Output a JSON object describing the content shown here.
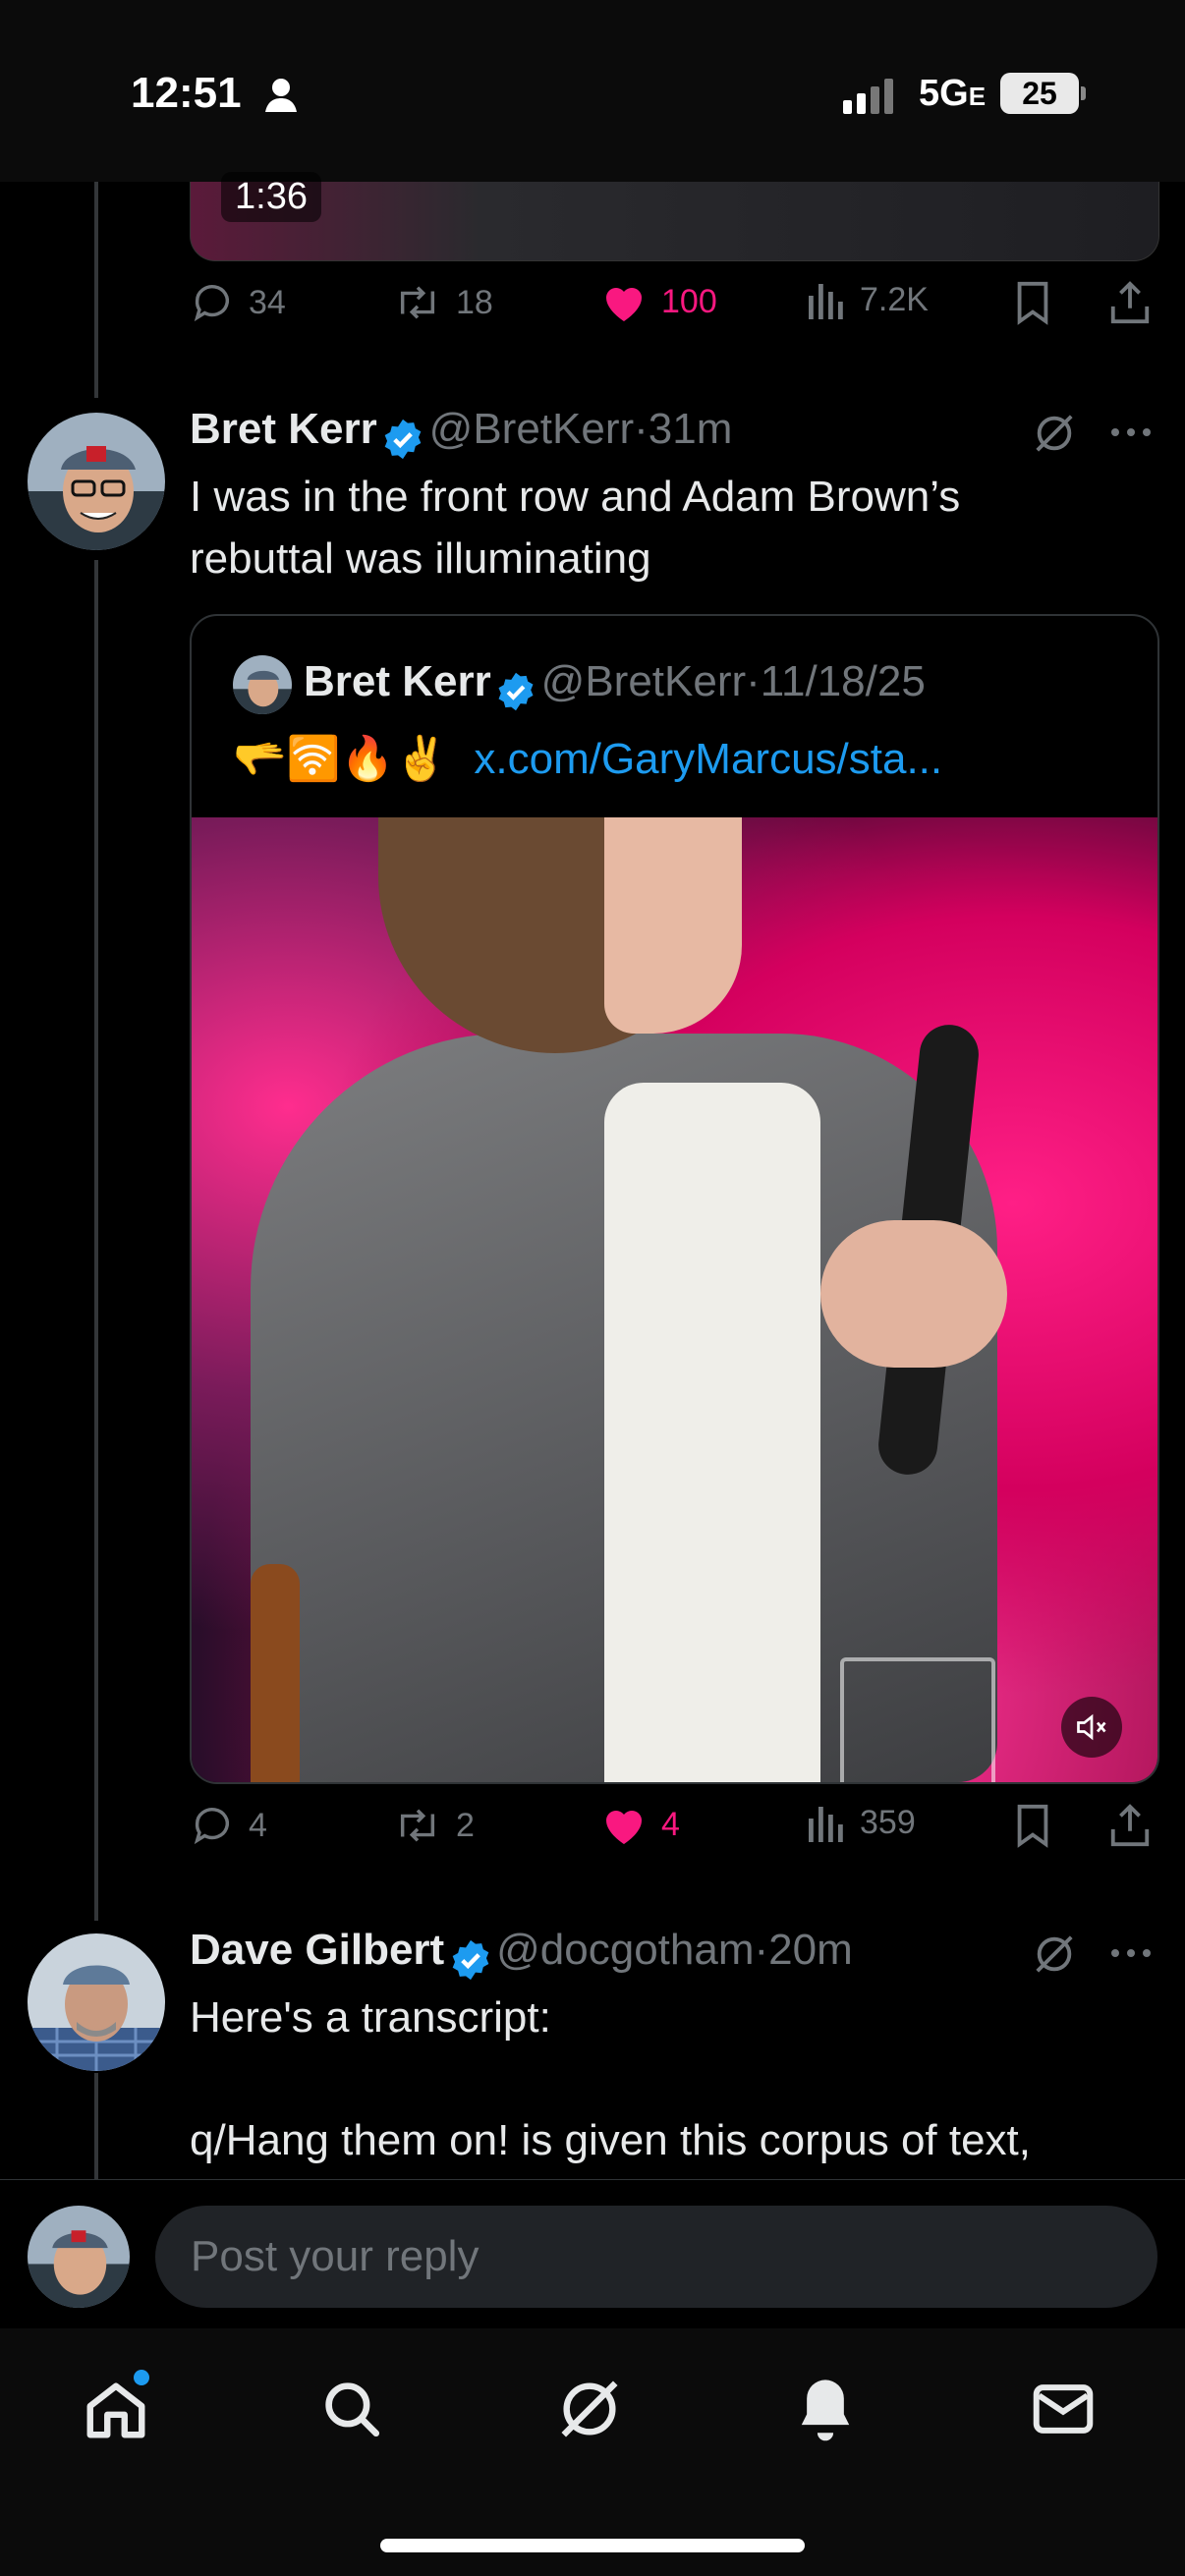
{
  "status_bar": {
    "time": "12:51",
    "network": "5G",
    "network_suffix": "E",
    "battery": "25"
  },
  "top_post": {
    "video_duration": "1:36",
    "replies": "34",
    "reposts": "18",
    "likes": "100",
    "views": "7.2K"
  },
  "post_bret": {
    "name": "Bret Kerr",
    "handle": "@BretKerr",
    "time": "31m",
    "text_line1": "I was in the front row and Adam Brown’s",
    "text_line2": "rebuttal was illuminating",
    "quote": {
      "name": "Bret Kerr",
      "handle": "@BretKerr",
      "date": "11/18/25",
      "emojis": "🫳🛜🔥✌️",
      "link": "x.com/GaryMarcus/sta..."
    },
    "replies": "4",
    "reposts": "2",
    "likes": "4",
    "views": "359"
  },
  "post_dave": {
    "name": "Dave Gilbert",
    "handle": "@docgotham",
    "time": "20m",
    "text_line1": "Here's a transcript:",
    "text_line2": "q/Hang them on! is given this corpus of text,"
  },
  "reply_box": {
    "placeholder": "Post your reply"
  },
  "colors": {
    "like": "#f91880",
    "link": "#1d9bf0",
    "verified": "#1d9bf0",
    "muted": "#71767b"
  },
  "icons": [
    "reply-icon",
    "repost-icon",
    "heart-icon",
    "views-icon",
    "bookmark-icon",
    "share-icon",
    "grok-icon",
    "more-icon",
    "home-icon",
    "search-icon",
    "notifications-icon",
    "messages-icon",
    "mute-icon"
  ]
}
